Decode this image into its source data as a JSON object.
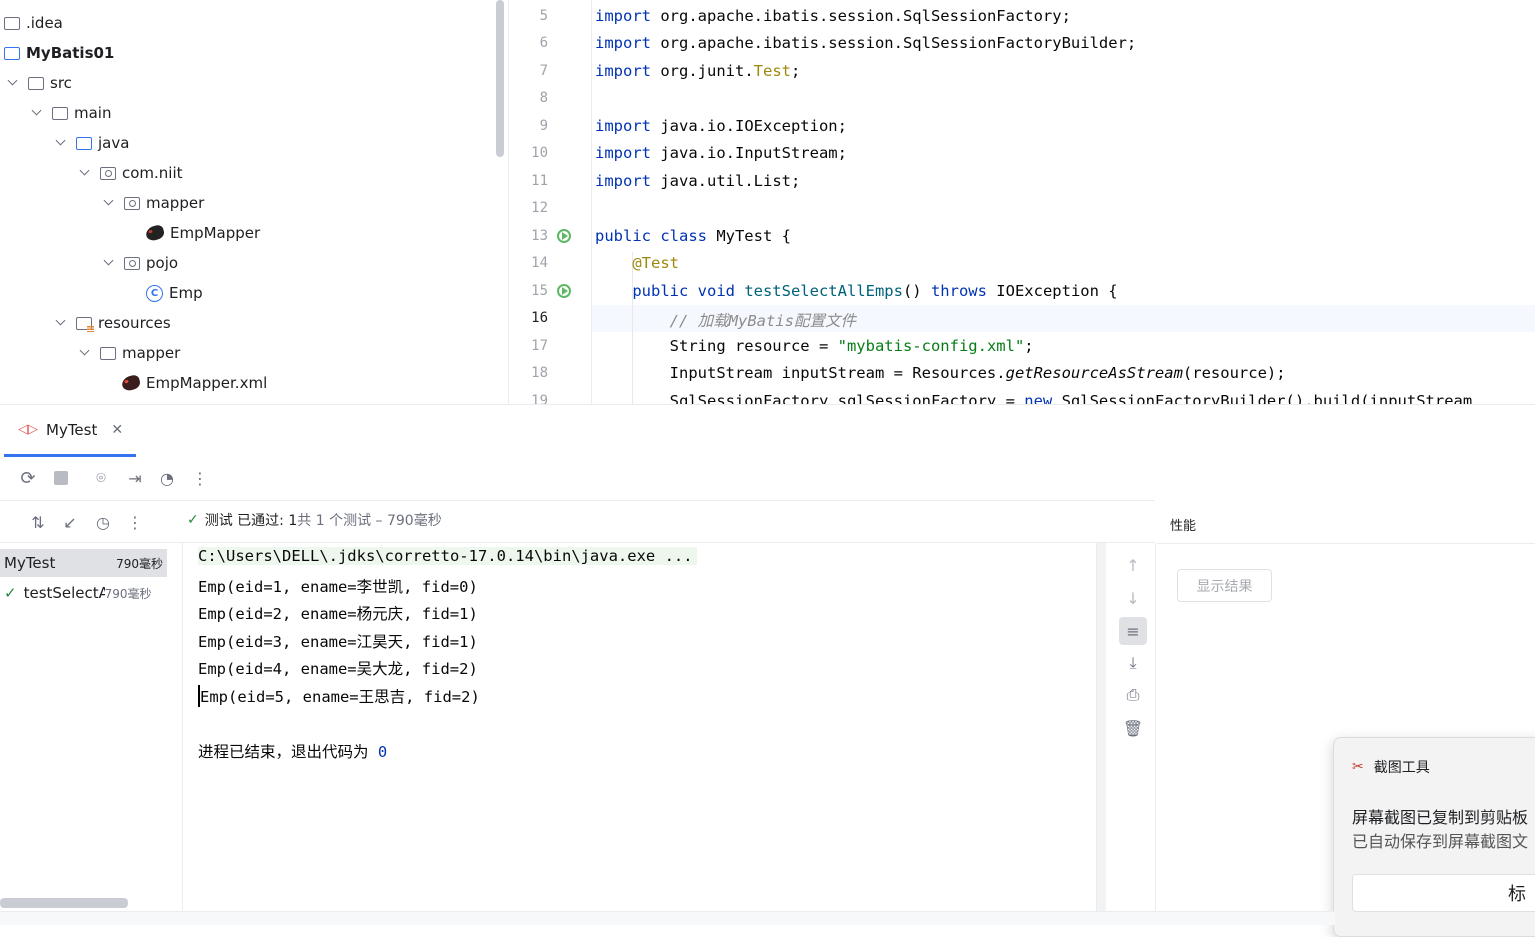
{
  "tree": {
    "items": [
      {
        "label": ".idea",
        "icon": "folder-icon"
      },
      {
        "label": "MyBatis01",
        "icon": "module-icon"
      },
      {
        "label": "src",
        "icon": "folder-icon"
      },
      {
        "label": "main",
        "icon": "folder-icon"
      },
      {
        "label": "java",
        "icon": "source-folder-icon"
      },
      {
        "label": "com.niit",
        "icon": "package-icon"
      },
      {
        "label": "mapper",
        "icon": "package-icon"
      },
      {
        "label": "EmpMapper",
        "icon": "mybatis-icon"
      },
      {
        "label": "pojo",
        "icon": "package-icon"
      },
      {
        "label": "Emp",
        "icon": "class-icon"
      },
      {
        "label": "resources",
        "icon": "resources-folder-icon"
      },
      {
        "label": "mapper",
        "icon": "folder-icon"
      },
      {
        "label": "EmpMapper.xml",
        "icon": "mybatis-xml-icon"
      }
    ]
  },
  "editor": {
    "line_numbers": [
      "5",
      "6",
      "7",
      "8",
      "9",
      "10",
      "11",
      "12",
      "13",
      "14",
      "15",
      "16",
      "17",
      "18",
      "19"
    ],
    "lines": {
      "l5a": "import",
      "l5b": " org.apache.ibatis.session.SqlSessionFactory;",
      "l6a": "import",
      "l6b": " org.apache.ibatis.session.SqlSessionFactoryBuilder;",
      "l7a": "import",
      "l7b": " org.junit.",
      "l7c": "Test",
      "l7d": ";",
      "l9a": "import",
      "l9b": " java.io.IOException;",
      "l10a": "import",
      "l10b": " java.io.InputStream;",
      "l11a": "import",
      "l11b": " java.util.List;",
      "l13a": "public class",
      "l13b": " MyTest {",
      "l14": "    @Test",
      "l15a": "    public void",
      "l15b": " testSelectAllEmps",
      "l15c": "() ",
      "l15d": "throws",
      "l15e": " IOException {",
      "l16": "        // 加载MyBatis配置文件",
      "l17a": "        String resource = ",
      "l17b": "\"mybatis-config.xml\"",
      "l17c": ";",
      "l18a": "        InputStream inputStream = Resources.",
      "l18b": "getResourceAsStream",
      "l18c": "(resource);",
      "l19a": "        SqlSessionFactory sqlSessionFactory = ",
      "l19b": "new",
      "l19c": " SqlSessionFactoryBuilder().build(inputStream"
    }
  },
  "run": {
    "tab_label": "MyTest",
    "status_pass": "测试 已通过: 1",
    "status_total": "共 1 个测试 – 790毫秒",
    "tests": [
      {
        "name": "MyTest",
        "time": "790毫秒"
      },
      {
        "name": "testSelectA",
        "time": "790毫秒"
      }
    ],
    "console": [
      "C:\\Users\\DELL\\.jdks\\corretto-17.0.14\\bin\\java.exe ...",
      "Emp(eid=1, ename=李世凯, fid=0)",
      "Emp(eid=2, ename=杨元庆, fid=1)",
      "Emp(eid=3, ename=江昊天, fid=1)",
      "Emp(eid=4, ename=吴大龙, fid=2)",
      "Emp(eid=5, ename=王思吉, fid=2)",
      "",
      "进程已结束，退出代码为 ",
      "0"
    ]
  },
  "perf": {
    "title": "性能",
    "show_results": "显示结果"
  },
  "toast": {
    "app": "截图工具",
    "line1": "屏幕截图已复制到剪贴板",
    "line2": "已自动保存到屏幕截图文",
    "button": "标"
  }
}
